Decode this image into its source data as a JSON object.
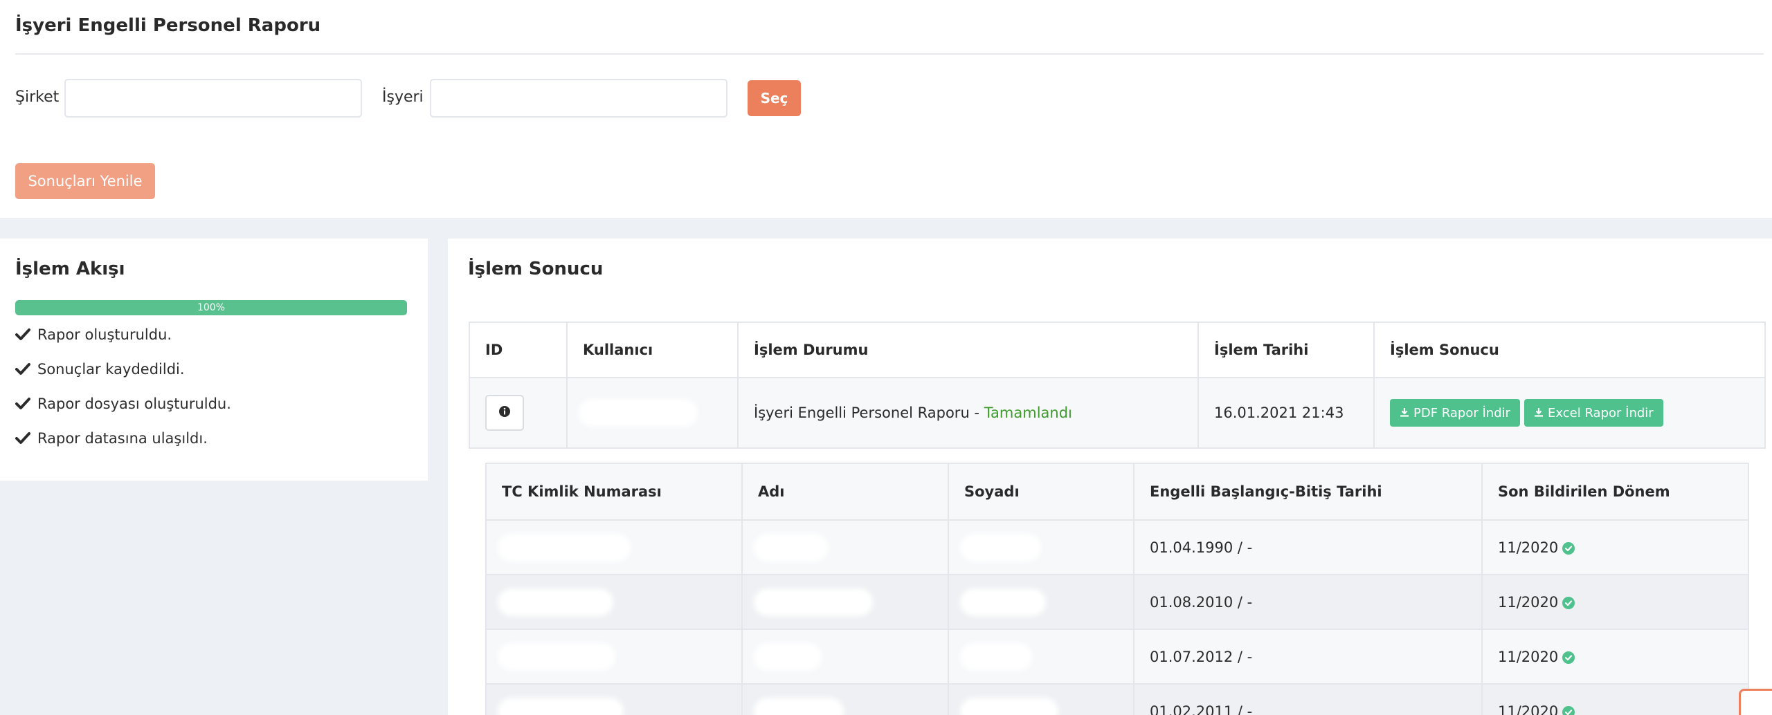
{
  "page": {
    "title": "İşyeri Engelli Personel Raporu"
  },
  "filters": {
    "company_label": "Şirket",
    "company_value": "",
    "workplace_label": "İşyeri",
    "workplace_value": "",
    "select_button": "Seç",
    "refresh_button": "Sonuçları Yenile"
  },
  "flow": {
    "title": "İşlem Akışı",
    "progress_percent": 100,
    "progress_label": "100%",
    "steps": [
      "Rapor oluşturuldu.",
      "Sonuçlar kaydedildi.",
      "Rapor dosyası oluşturuldu.",
      "Rapor datasına ulaşıldı."
    ]
  },
  "result": {
    "title": "İşlem Sonucu",
    "columns": [
      "ID",
      "Kullanıcı",
      "İşlem Durumu",
      "İşlem Tarihi",
      "İşlem Sonucu"
    ],
    "row": {
      "status_text": "İşyeri Engelli Personel Raporu - ",
      "status_done": "Tamamlandı",
      "date": "16.01.2021 21:43",
      "pdf_button": "PDF Rapor İndir",
      "excel_button": "Excel Rapor İndir"
    },
    "detail": {
      "columns": [
        "TC Kimlik Numarası",
        "Adı",
        "Soyadı",
        "Engelli Başlangıç-Bitiş Tarihi",
        "Son Bildirilen Dönem"
      ],
      "rows": [
        {
          "dates": "01.04.1990 / -",
          "period": "11/2020"
        },
        {
          "dates": "01.08.2010 / -",
          "period": "11/2020"
        },
        {
          "dates": "01.07.2012 / -",
          "period": "11/2020"
        },
        {
          "dates": "01.02.2011 / -",
          "period": "11/2020"
        }
      ]
    }
  },
  "colors": {
    "accent": "#ec7f5c",
    "success": "#59c18e",
    "status_ok": "#3f9a2c"
  },
  "icons": {
    "step": "check-icon",
    "info": "info-circle-icon",
    "download": "download-icon",
    "period": "check-circle-icon"
  }
}
